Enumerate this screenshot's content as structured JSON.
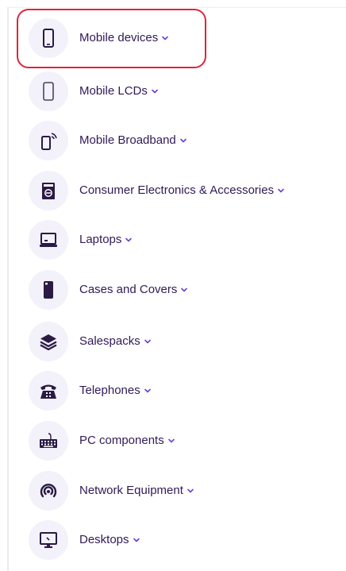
{
  "categories": [
    {
      "label": "Mobile devices",
      "icon": "mobile-phone-icon"
    },
    {
      "label": "Mobile LCDs",
      "icon": "mobile-lcd-icon"
    },
    {
      "label": "Mobile Broadband",
      "icon": "mobile-broadband-icon"
    },
    {
      "label": "Consumer Electronics & Accessories",
      "icon": "consumer-electronics-icon"
    },
    {
      "label": "Laptops",
      "icon": "laptop-icon"
    },
    {
      "label": "Cases and Covers",
      "icon": "phone-case-icon"
    },
    {
      "label": "Salespacks",
      "icon": "layers-icon"
    },
    {
      "label": "Telephones",
      "icon": "telephone-icon"
    },
    {
      "label": "PC components",
      "icon": "keyboard-icon"
    },
    {
      "label": "Network Equipment",
      "icon": "wifi-router-icon"
    },
    {
      "label": "Desktops",
      "icon": "desktop-icon"
    }
  ],
  "colors": {
    "label_text": "#301a55",
    "icon_dark": "#2a1a44",
    "icon_bg": "#f3f1fa",
    "chevron": "#6a3fd6",
    "highlight_border": "#d9283a"
  }
}
